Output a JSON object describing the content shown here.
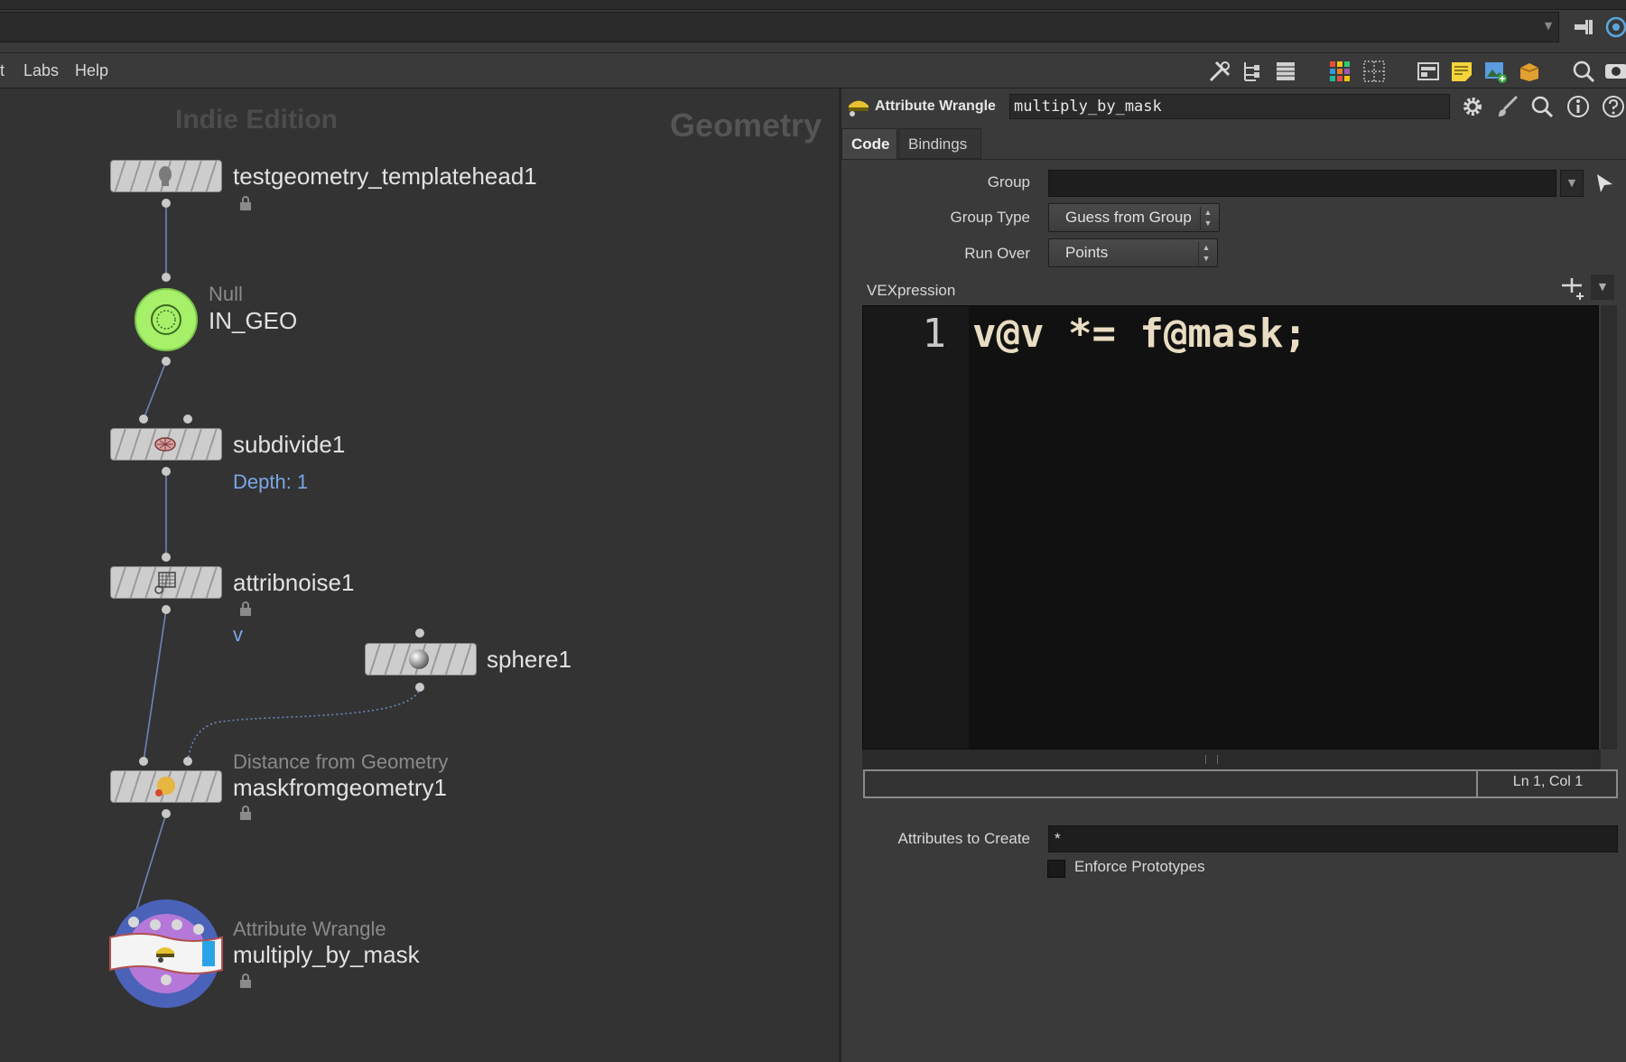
{
  "menu": {
    "items": [
      "t",
      "Labs",
      "Help"
    ]
  },
  "network": {
    "watermark_edition": "Indie Edition",
    "watermark_context": "Geometry",
    "nodes": [
      {
        "name": "testgeometry_templatehead1",
        "type": "",
        "info": "",
        "locked": true
      },
      {
        "name": "IN_GEO",
        "type": "Null",
        "info": "",
        "locked": false
      },
      {
        "name": "subdivide1",
        "type": "",
        "info": "Depth: 1",
        "locked": false
      },
      {
        "name": "attribnoise1",
        "type": "",
        "info": "v",
        "locked": true
      },
      {
        "name": "sphere1",
        "type": "",
        "info": "",
        "locked": false
      },
      {
        "name": "maskfromgeometry1",
        "type": "Distance from Geometry",
        "info": "",
        "locked": true
      },
      {
        "name": "multiply_by_mask",
        "type": "Attribute Wrangle",
        "info": "",
        "locked": true
      }
    ]
  },
  "params": {
    "node_type": "Attribute Wrangle",
    "node_name": "multiply_by_mask",
    "tabs": [
      "Code",
      "Bindings"
    ],
    "active_tab": "Code",
    "group_label": "Group",
    "group_value": "",
    "group_type_label": "Group Type",
    "group_type_value": "Guess from Group",
    "run_over_label": "Run Over",
    "run_over_value": "Points",
    "vex_label": "VEXpression",
    "line_number": "1",
    "code": "v@v *= f@mask;",
    "cursor_pos": "Ln 1, Col 1",
    "attrs_label": "Attributes to Create",
    "attrs_value": "*",
    "enforce_label": "Enforce Prototypes",
    "enforce_checked": false
  },
  "colors": {
    "background": "#333333",
    "null_node": "#a6f06a",
    "wrangle_ring": "#4a62b8",
    "wrangle_inner": "#b678d8",
    "wire": "#6c86b8",
    "info_text": "#7aa7e6",
    "code_text": "#e8dcc2"
  }
}
